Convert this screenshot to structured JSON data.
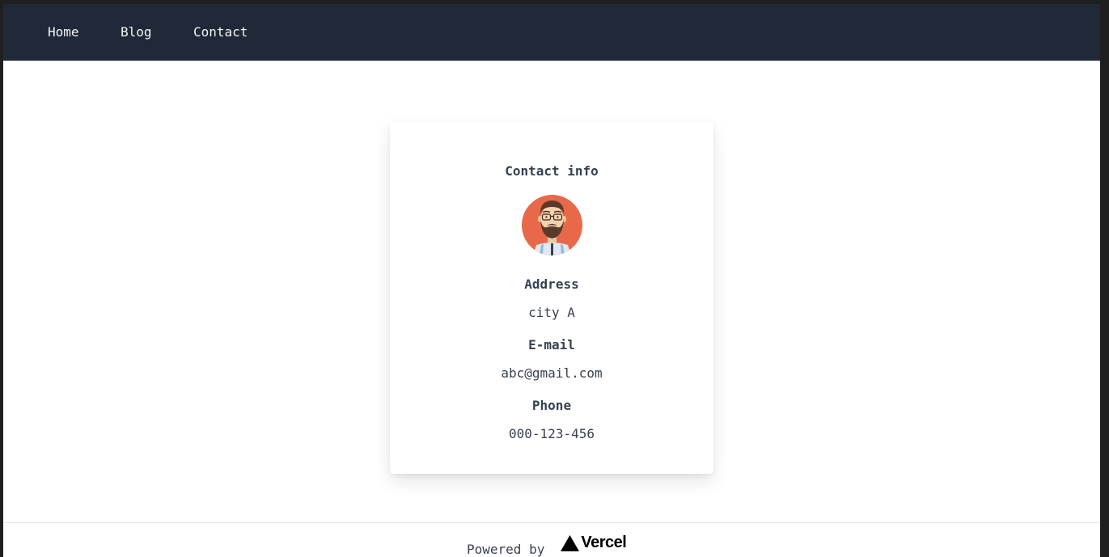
{
  "nav": {
    "items": [
      {
        "label": "Home"
      },
      {
        "label": "Blog"
      },
      {
        "label": "Contact"
      }
    ]
  },
  "card": {
    "title": "Contact info",
    "avatar": "bearded-man-avatar",
    "fields": {
      "address": {
        "label": "Address",
        "value": "city A"
      },
      "email": {
        "label": "E-mail",
        "value": "abc@gmail.com"
      },
      "phone": {
        "label": "Phone",
        "value": "000-123-456"
      }
    }
  },
  "footer": {
    "powered_by": "Powered by",
    "brand": "Vercel"
  },
  "colors": {
    "navbar_bg": "#1f2937",
    "avatar_bg": "#e8694a",
    "text": "#374151"
  }
}
